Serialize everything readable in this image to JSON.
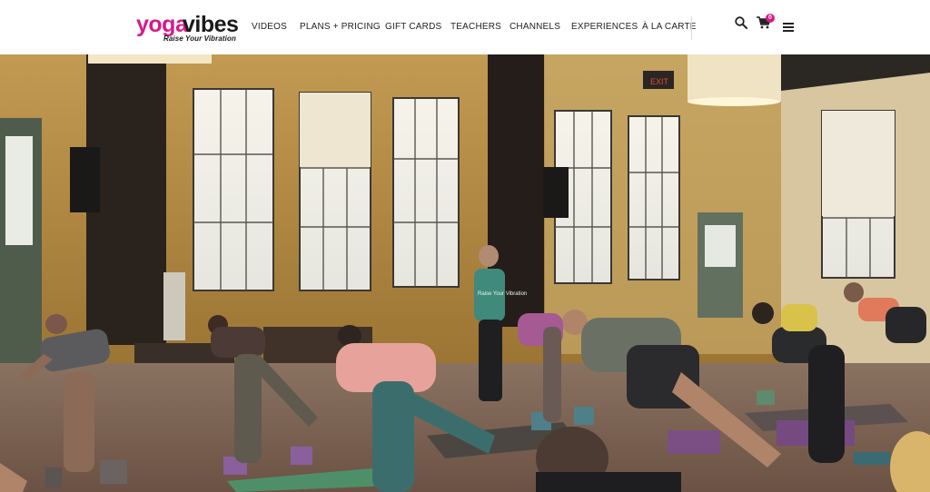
{
  "brand": {
    "name_part1": "yoga",
    "name_part2": "vibes",
    "tagline": "Raise Your Vibration",
    "colors": {
      "accent": "#d51a8a",
      "text": "#1a1a1a"
    }
  },
  "nav": {
    "items": [
      {
        "label": "VIDEOS"
      },
      {
        "label": "PLANS + PRICING"
      },
      {
        "label": "GIFT CARDS"
      },
      {
        "label": "TEACHERS"
      },
      {
        "label": "CHANNELS"
      },
      {
        "label": "EXPERIENCES"
      },
      {
        "label": "À LA CARTE"
      }
    ]
  },
  "header_icons": {
    "search": "search-icon",
    "cart": "cart-icon",
    "cart_count": "0",
    "menu": "hamburger-menu-icon"
  },
  "hero": {
    "scene": "photo-group-yoga-class",
    "exit_sign": "EXIT",
    "shirt_text": "Raise Your Vibration"
  }
}
